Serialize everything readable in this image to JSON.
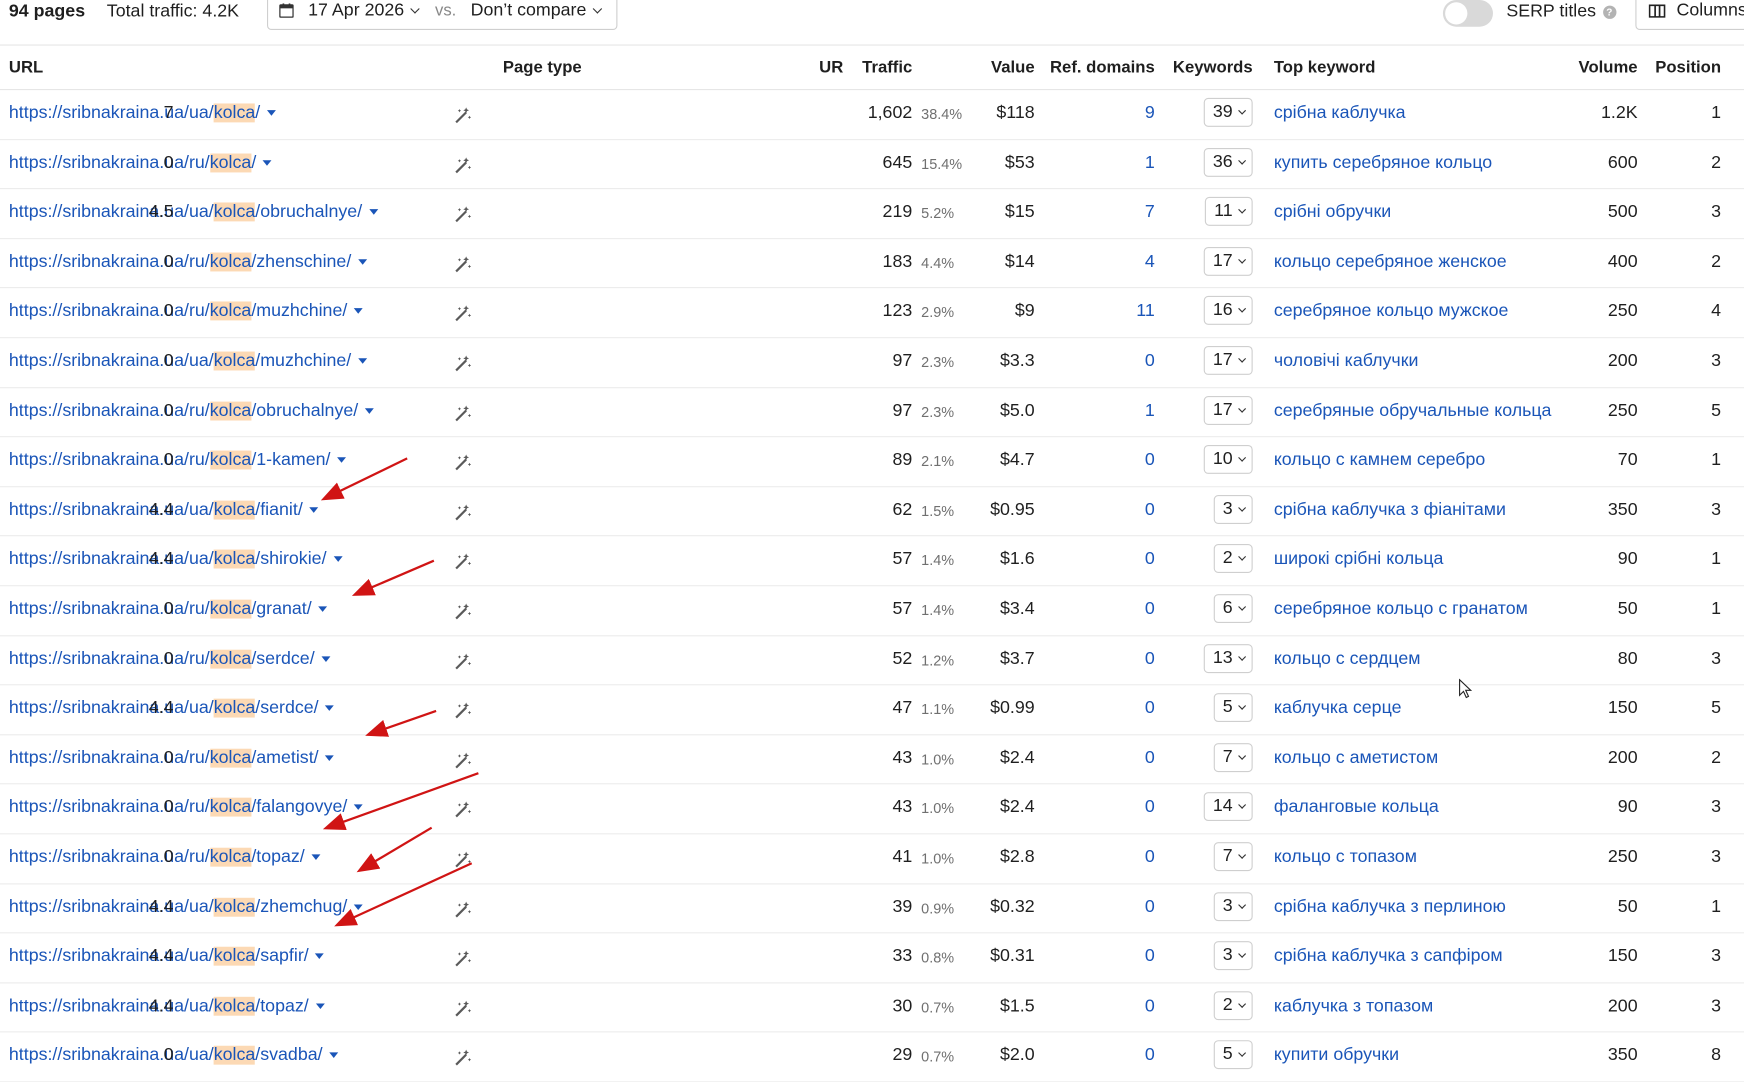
{
  "header": {
    "pages": "94 pages",
    "total_traffic": "Total traffic: 4.2K",
    "date": "17 Apr 2026",
    "vs": "vs.",
    "compare": "Don’t compare",
    "serp_titles": "SERP titles",
    "serp_toggle_on": false,
    "columns": "Columns",
    "help": "?"
  },
  "columns": {
    "url": "URL",
    "page_type": "Page type",
    "ur": "UR",
    "traffic": "Traffic",
    "value": "Value",
    "ref_domains": "Ref. domains",
    "keywords": "Keywords",
    "top_keyword": "Top keyword",
    "volume": "Volume",
    "position": "Position"
  },
  "colors": {
    "link": "#1a55b8",
    "highlight": "#fcd9b4",
    "annotation_arrow": "#d01414"
  },
  "rows": [
    {
      "url_pre": "https://sribnakraina.ua/ua/",
      "url_hl": "kolca",
      "url_post": "/",
      "ur": "7",
      "traffic": "1,602",
      "pct": "38.4%",
      "value": "$118",
      "ref": "9",
      "kw": "39",
      "top": "срібна каблучка",
      "vol": "1.2K",
      "pos": "1"
    },
    {
      "url_pre": "https://sribnakraina.ua/ru/",
      "url_hl": "kolca",
      "url_post": "/",
      "ur": "0",
      "traffic": "645",
      "pct": "15.4%",
      "value": "$53",
      "ref": "1",
      "kw": "36",
      "top": "купить серебряное кольцо",
      "vol": "600",
      "pos": "2"
    },
    {
      "url_pre": "https://sribnakraina.ua/ua/",
      "url_hl": "kolca",
      "url_post": "/obruchalnye/",
      "ur": "4.5",
      "traffic": "219",
      "pct": "5.2%",
      "value": "$15",
      "ref": "7",
      "kw": "11",
      "top": "срібні обручки",
      "vol": "500",
      "pos": "3"
    },
    {
      "url_pre": "https://sribnakraina.ua/ru/",
      "url_hl": "kolca",
      "url_post": "/zhenschine/",
      "ur": "0",
      "traffic": "183",
      "pct": "4.4%",
      "value": "$14",
      "ref": "4",
      "kw": "17",
      "top": "кольцо серебряное женское",
      "vol": "400",
      "pos": "2"
    },
    {
      "url_pre": "https://sribnakraina.ua/ru/",
      "url_hl": "kolca",
      "url_post": "/muzhchine/",
      "ur": "0",
      "traffic": "123",
      "pct": "2.9%",
      "value": "$9",
      "ref": "11",
      "kw": "16",
      "top": "серебряное кольцо мужское",
      "vol": "250",
      "pos": "4"
    },
    {
      "url_pre": "https://sribnakraina.ua/ua/",
      "url_hl": "kolca",
      "url_post": "/muzhchine/",
      "ur": "0",
      "traffic": "97",
      "pct": "2.3%",
      "value": "$3.3",
      "ref": "0",
      "kw": "17",
      "top": "чоловічі каблучки",
      "vol": "200",
      "pos": "3"
    },
    {
      "url_pre": "https://sribnakraina.ua/ru/",
      "url_hl": "kolca",
      "url_post": "/obruchalnye/",
      "ur": "0",
      "traffic": "97",
      "pct": "2.3%",
      "value": "$5.0",
      "ref": "1",
      "kw": "17",
      "top": "серебряные обручальные кольца",
      "vol": "250",
      "pos": "5"
    },
    {
      "url_pre": "https://sribnakraina.ua/ru/",
      "url_hl": "kolca",
      "url_post": "/1-kamen/",
      "ur": "0",
      "traffic": "89",
      "pct": "2.1%",
      "value": "$4.7",
      "ref": "0",
      "kw": "10",
      "top": "кольцо с камнем серебро",
      "vol": "70",
      "pos": "1"
    },
    {
      "url_pre": "https://sribnakraina.ua/ua/",
      "url_hl": "kolca",
      "url_post": "/fianit/",
      "ur": "4.4",
      "traffic": "62",
      "pct": "1.5%",
      "value": "$0.95",
      "ref": "0",
      "kw": "3",
      "top": "срібна каблучка з фіанітами",
      "vol": "350",
      "pos": "3"
    },
    {
      "url_pre": "https://sribnakraina.ua/ua/",
      "url_hl": "kolca",
      "url_post": "/shirokie/",
      "ur": "4.4",
      "traffic": "57",
      "pct": "1.4%",
      "value": "$1.6",
      "ref": "0",
      "kw": "2",
      "top": "широкі срібні кольца",
      "vol": "90",
      "pos": "1"
    },
    {
      "url_pre": "https://sribnakraina.ua/ru/",
      "url_hl": "kolca",
      "url_post": "/granat/",
      "ur": "0",
      "traffic": "57",
      "pct": "1.4%",
      "value": "$3.4",
      "ref": "0",
      "kw": "6",
      "top": "серебряное кольцо с гранатом",
      "vol": "50",
      "pos": "1"
    },
    {
      "url_pre": "https://sribnakraina.ua/ru/",
      "url_hl": "kolca",
      "url_post": "/serdce/",
      "ur": "0",
      "traffic": "52",
      "pct": "1.2%",
      "value": "$3.7",
      "ref": "0",
      "kw": "13",
      "top": "кольцо с сердцем",
      "vol": "80",
      "pos": "3"
    },
    {
      "url_pre": "https://sribnakraina.ua/ua/",
      "url_hl": "kolca",
      "url_post": "/serdce/",
      "ur": "4.4",
      "traffic": "47",
      "pct": "1.1%",
      "value": "$0.99",
      "ref": "0",
      "kw": "5",
      "top": "каблучка серце",
      "vol": "150",
      "pos": "5"
    },
    {
      "url_pre": "https://sribnakraina.ua/ru/",
      "url_hl": "kolca",
      "url_post": "/ametist/",
      "ur": "0",
      "traffic": "43",
      "pct": "1.0%",
      "value": "$2.4",
      "ref": "0",
      "kw": "7",
      "top": "кольцо с аметистом",
      "vol": "200",
      "pos": "2"
    },
    {
      "url_pre": "https://sribnakraina.ua/ru/",
      "url_hl": "kolca",
      "url_post": "/falangovye/",
      "ur": "0",
      "traffic": "43",
      "pct": "1.0%",
      "value": "$2.4",
      "ref": "0",
      "kw": "14",
      "top": "фаланговые кольца",
      "vol": "90",
      "pos": "3"
    },
    {
      "url_pre": "https://sribnakraina.ua/ru/",
      "url_hl": "kolca",
      "url_post": "/topaz/",
      "ur": "0",
      "traffic": "41",
      "pct": "1.0%",
      "value": "$2.8",
      "ref": "0",
      "kw": "7",
      "top": "кольцо с топазом",
      "vol": "250",
      "pos": "3"
    },
    {
      "url_pre": "https://sribnakraina.ua/ua/",
      "url_hl": "kolca",
      "url_post": "/zhemchug/",
      "ur": "4.4",
      "traffic": "39",
      "pct": "0.9%",
      "value": "$0.32",
      "ref": "0",
      "kw": "3",
      "top": "срібна каблучка з перлиною",
      "vol": "50",
      "pos": "1"
    },
    {
      "url_pre": "https://sribnakraina.ua/ua/",
      "url_hl": "kolca",
      "url_post": "/sapfir/",
      "ur": "4.4",
      "traffic": "33",
      "pct": "0.8%",
      "value": "$0.31",
      "ref": "0",
      "kw": "3",
      "top": "срібна каблучка з сапфіром",
      "vol": "150",
      "pos": "3"
    },
    {
      "url_pre": "https://sribnakraina.ua/ua/",
      "url_hl": "kolca",
      "url_post": "/topaz/",
      "ur": "4.4",
      "traffic": "30",
      "pct": "0.7%",
      "value": "$1.5",
      "ref": "0",
      "kw": "2",
      "top": "каблучка з топазом",
      "vol": "200",
      "pos": "3"
    },
    {
      "url_pre": "https://sribnakraina.ua/ua/",
      "url_hl": "kolca",
      "url_post": "/svadba/",
      "ur": "0",
      "traffic": "29",
      "pct": "0.7%",
      "value": "$2.0",
      "ref": "0",
      "kw": "5",
      "top": "купити обручки",
      "vol": "350",
      "pos": "8"
    }
  ]
}
